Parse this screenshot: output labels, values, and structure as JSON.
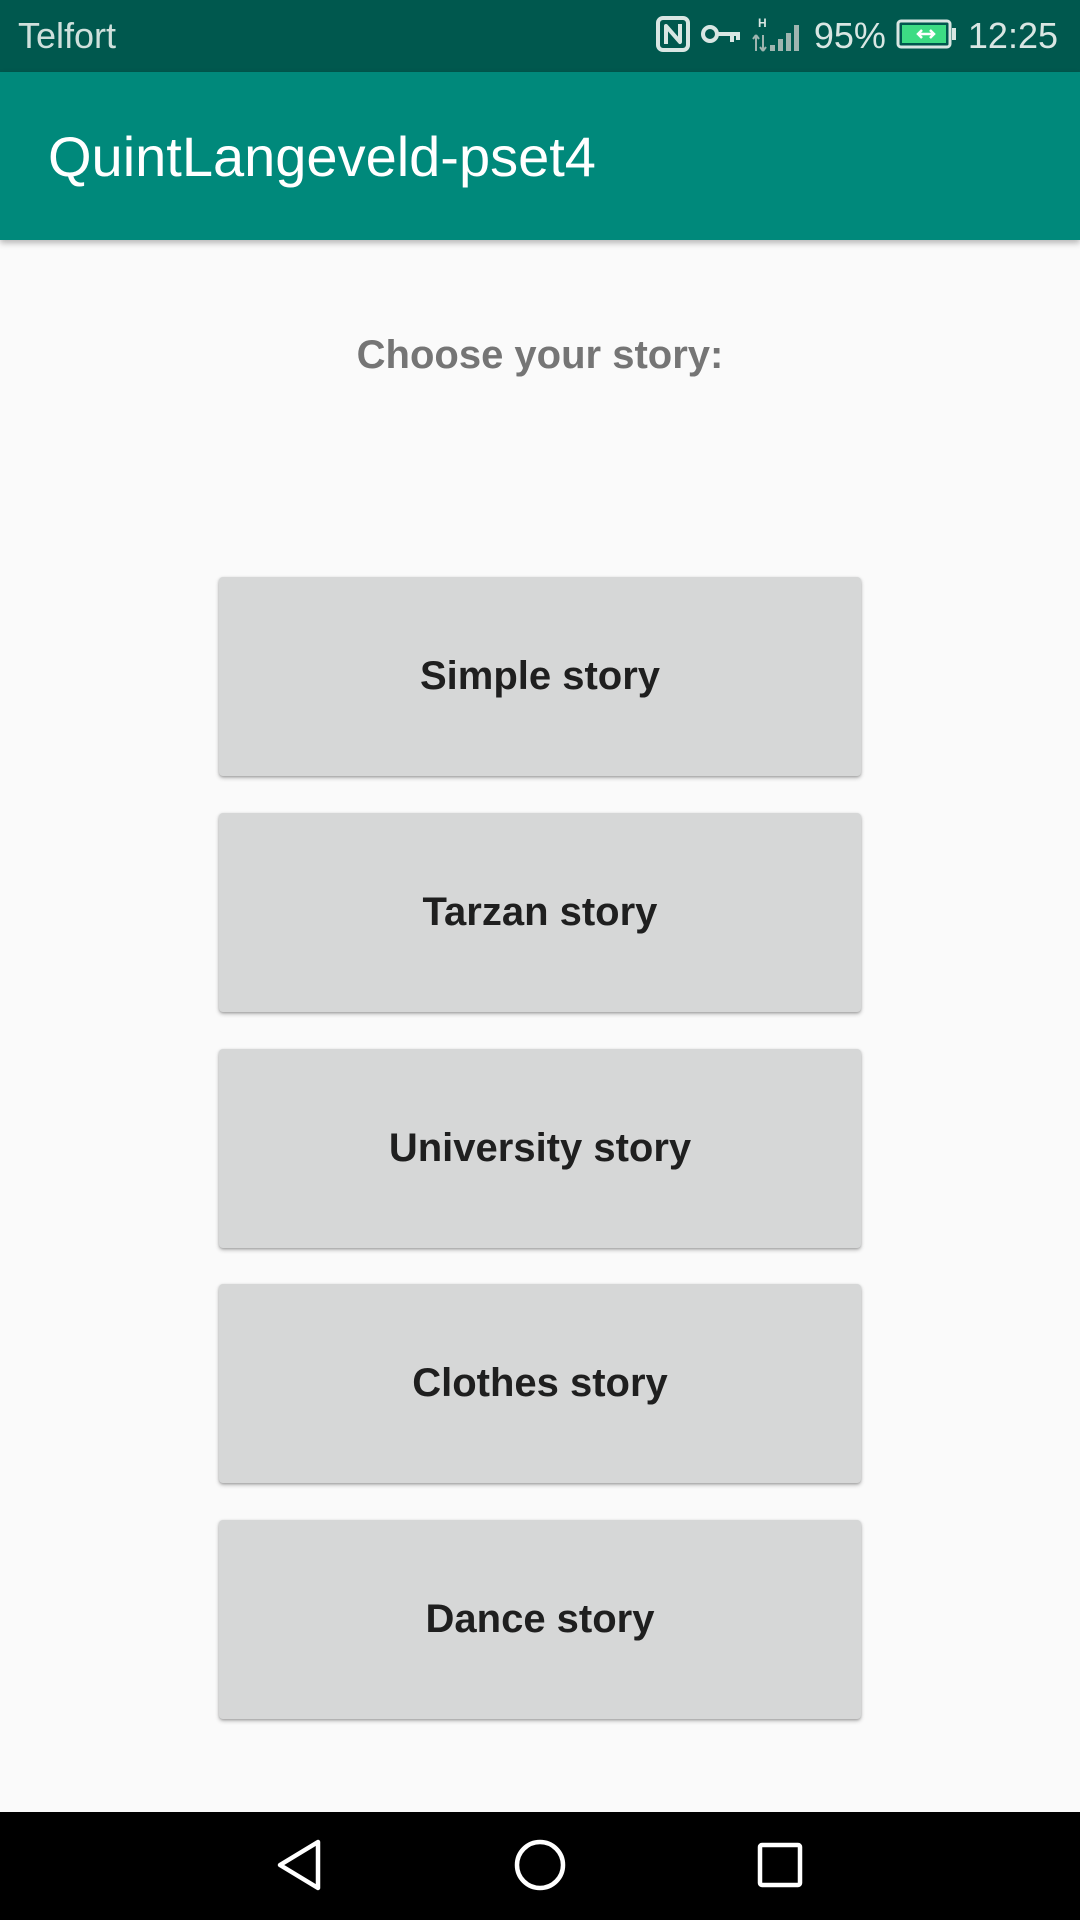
{
  "status_bar": {
    "carrier": "Telfort",
    "network_type": "H",
    "battery_percent": "95%",
    "time": "12:25",
    "icons": [
      "nfc-icon",
      "vpn-key-icon",
      "signal-icon",
      "battery-charging-icon"
    ]
  },
  "app_bar": {
    "title": "QuintLangeveld-pset4",
    "color": "#00897b"
  },
  "main": {
    "prompt": "Choose your story:",
    "stories": [
      {
        "label": "Simple story"
      },
      {
        "label": "Tarzan story"
      },
      {
        "label": "University story"
      },
      {
        "label": "Clothes story"
      },
      {
        "label": "Dance story"
      }
    ]
  },
  "nav_bar": {
    "icons": [
      "back-icon",
      "home-icon",
      "recents-icon"
    ]
  },
  "colors": {
    "status_bar": "#00584e",
    "app_bar": "#00897b",
    "button": "#d6d7d7",
    "battery": "#3ddc84"
  }
}
